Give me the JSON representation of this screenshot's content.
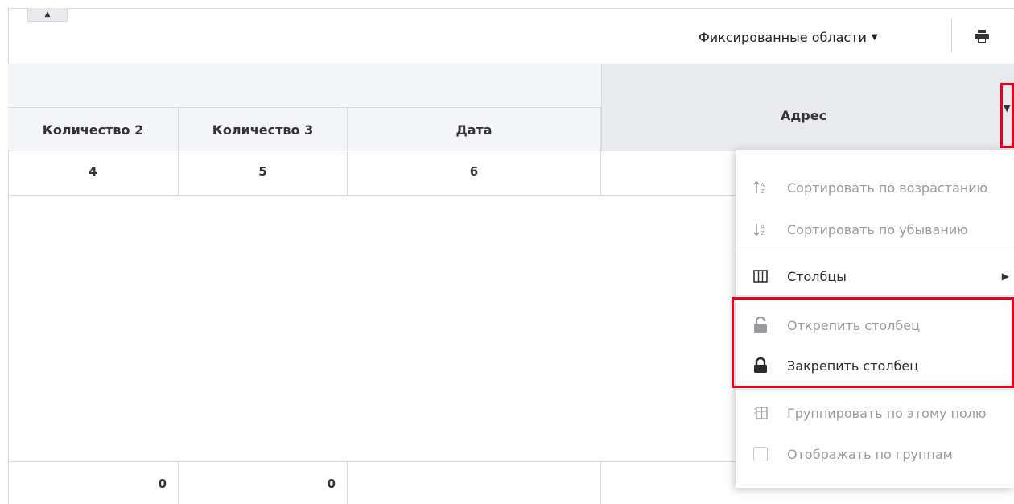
{
  "toolbar": {
    "fixed_areas_label": "Фиксированные области",
    "print_icon": "print-icon"
  },
  "grid": {
    "columns": [
      "Количество 2",
      "Количество 3",
      "Дата",
      "Адрес"
    ],
    "num_row": [
      "4",
      "5",
      "6",
      ""
    ],
    "footer_row": [
      "0",
      "0",
      "",
      ""
    ]
  },
  "menu": {
    "sort_asc": "Сортировать по возрастанию",
    "sort_desc": "Сортировать по убыванию",
    "columns": "Столбцы",
    "unpin": "Открепить столбец",
    "pin": "Закрепить столбец",
    "group_by": "Группировать по этому полю",
    "show_groups": "Отображать по группам"
  },
  "colors": {
    "highlight": "#e8001c",
    "header_bg": "#f4f5f8",
    "disabled_text": "#9a9aa0"
  }
}
